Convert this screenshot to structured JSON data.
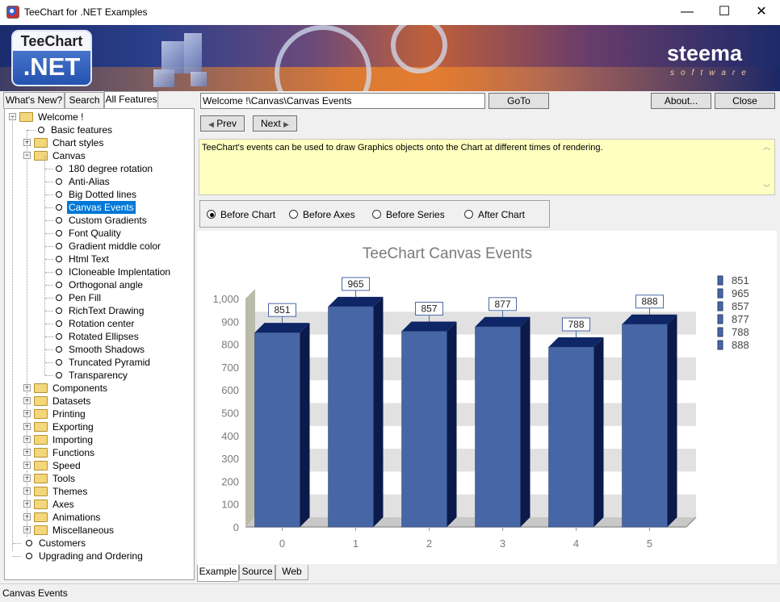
{
  "window": {
    "title": "TeeChart for .NET Examples",
    "min_glyph": "—",
    "max_glyph": "☐",
    "close_glyph": "✕"
  },
  "banner": {
    "logo_top": "TeeChart",
    "logo_bottom": ".NET",
    "brand": "steema",
    "brand_sub": "software"
  },
  "left_tabs": [
    {
      "label": "What's New?"
    },
    {
      "label": "Search"
    },
    {
      "label": "All Features"
    }
  ],
  "tree": [
    {
      "label": "Welcome !",
      "type": "folder-open",
      "level": 0,
      "expander": "−"
    },
    {
      "label": "Basic features",
      "type": "leaf",
      "level": 1
    },
    {
      "label": "Chart styles",
      "type": "folder",
      "level": 1,
      "expander": "+"
    },
    {
      "label": "Canvas",
      "type": "folder-open",
      "level": 1,
      "expander": "−"
    },
    {
      "label": "180 degree rotation",
      "type": "leaf",
      "level": 2
    },
    {
      "label": "Anti-Alias",
      "type": "leaf",
      "level": 2
    },
    {
      "label": "Big Dotted lines",
      "type": "leaf",
      "level": 2
    },
    {
      "label": "Canvas Events",
      "type": "leaf",
      "level": 2,
      "selected": true
    },
    {
      "label": "Custom Gradients",
      "type": "leaf",
      "level": 2
    },
    {
      "label": "Font Quality",
      "type": "leaf",
      "level": 2
    },
    {
      "label": "Gradient middle color",
      "type": "leaf",
      "level": 2
    },
    {
      "label": "Html Text",
      "type": "leaf",
      "level": 2
    },
    {
      "label": "ICloneable Implentation",
      "type": "leaf",
      "level": 2
    },
    {
      "label": "Orthogonal angle",
      "type": "leaf",
      "level": 2
    },
    {
      "label": "Pen Fill",
      "type": "leaf",
      "level": 2
    },
    {
      "label": "RichText Drawing",
      "type": "leaf",
      "level": 2
    },
    {
      "label": "Rotation center",
      "type": "leaf",
      "level": 2
    },
    {
      "label": "Rotated Ellipses",
      "type": "leaf",
      "level": 2
    },
    {
      "label": "Smooth Shadows",
      "type": "leaf",
      "level": 2
    },
    {
      "label": "Truncated Pyramid",
      "type": "leaf",
      "level": 2
    },
    {
      "label": "Transparency",
      "type": "leaf",
      "level": 2
    },
    {
      "label": "Components",
      "type": "folder",
      "level": 1,
      "expander": "+"
    },
    {
      "label": "Datasets",
      "type": "folder",
      "level": 1,
      "expander": "+"
    },
    {
      "label": "Printing",
      "type": "folder",
      "level": 1,
      "expander": "+"
    },
    {
      "label": "Exporting",
      "type": "folder",
      "level": 1,
      "expander": "+"
    },
    {
      "label": "Importing",
      "type": "folder",
      "level": 1,
      "expander": "+"
    },
    {
      "label": "Functions",
      "type": "folder",
      "level": 1,
      "expander": "+"
    },
    {
      "label": "Speed",
      "type": "folder",
      "level": 1,
      "expander": "+"
    },
    {
      "label": "Tools",
      "type": "folder",
      "level": 1,
      "expander": "+"
    },
    {
      "label": "Themes",
      "type": "folder",
      "level": 1,
      "expander": "+"
    },
    {
      "label": "Axes",
      "type": "folder",
      "level": 1,
      "expander": "+"
    },
    {
      "label": "Animations",
      "type": "folder",
      "level": 1,
      "expander": "+"
    },
    {
      "label": "Miscellaneous",
      "type": "folder",
      "level": 1,
      "expander": "+"
    },
    {
      "label": "Customers",
      "type": "leaf",
      "level": 0
    },
    {
      "label": "Upgrading and Ordering",
      "type": "leaf",
      "level": 0
    }
  ],
  "toolbar": {
    "path_value": "Welcome !\\Canvas\\Canvas Events",
    "goto_label": "GoTo",
    "about_label": "About...",
    "close_label": "Close",
    "prev_label": "Prev",
    "next_label": "Next"
  },
  "description": "TeeChart's events can be used to draw Graphics objects onto the Chart at different times of rendering.",
  "radio_options": [
    {
      "label": "Before Chart",
      "checked": true
    },
    {
      "label": "Before Axes",
      "checked": false
    },
    {
      "label": "Before Series",
      "checked": false
    },
    {
      "label": "After Chart",
      "checked": false
    }
  ],
  "bottom_tabs": [
    {
      "label": "Example",
      "active": true
    },
    {
      "label": "Source",
      "active": false
    },
    {
      "label": "Web",
      "active": false
    }
  ],
  "status_text": "Canvas Events",
  "colors": {
    "bar_front": "#4766a6",
    "bar_top": "#0e2566",
    "bar_side": "#0b1a4a",
    "band": "#e1e1e1",
    "axis_wall": "#bbbbaa",
    "selection": "#0078d7",
    "desc_bg": "#ffffc0"
  },
  "chart_data": {
    "type": "bar",
    "title": "TeeChart Canvas Events",
    "categories": [
      "0",
      "1",
      "2",
      "3",
      "4",
      "5"
    ],
    "values": [
      851,
      965,
      857,
      877,
      788,
      888
    ],
    "value_labels": [
      "851",
      "965",
      "857",
      "877",
      "788",
      "888"
    ],
    "yticks": [
      "0",
      "100",
      "200",
      "300",
      "400",
      "500",
      "600",
      "700",
      "800",
      "900",
      "1,000"
    ],
    "ylim": [
      0,
      1000
    ],
    "legend": [
      "851",
      "965",
      "857",
      "877",
      "788",
      "888"
    ],
    "legend_position": "right",
    "grid": true,
    "three_d": true
  }
}
